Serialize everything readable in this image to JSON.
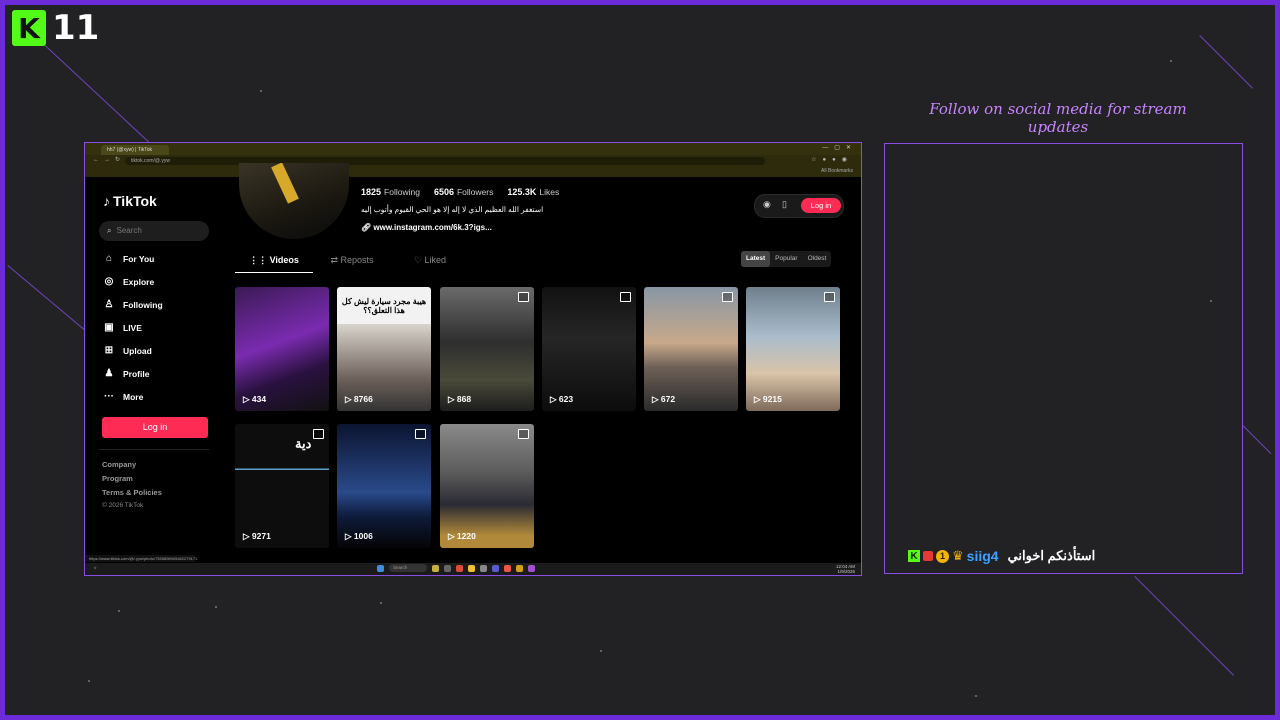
{
  "overlay": {
    "kick_badge": "11",
    "follow_text": "Follow on social media for stream updates",
    "chat": {
      "user": "siig4",
      "message": "استأذنكم اخواني"
    },
    "accent_color": "#6c2bd9"
  },
  "browser": {
    "tab_title": "hh7 (@xyw) | TikTok",
    "url": "tiktok.com/@.yyw",
    "bookmark_right": "All Bookmarks",
    "status_url": "https://www.tiktok.com/@/.yyw/photo/7355898905462279171"
  },
  "tiktok": {
    "brand": "TikTok",
    "search_placeholder": "Search",
    "nav": [
      {
        "label": "For You",
        "icon": "home-icon"
      },
      {
        "label": "Explore",
        "icon": "compass-icon"
      },
      {
        "label": "Following",
        "icon": "following-icon"
      },
      {
        "label": "LIVE",
        "icon": "live-icon"
      },
      {
        "label": "Upload",
        "icon": "upload-icon"
      },
      {
        "label": "Profile",
        "icon": "profile-icon"
      },
      {
        "label": "More",
        "icon": "more-icon"
      }
    ],
    "login_label": "Log in",
    "footer": {
      "company": "Company",
      "program": "Program",
      "terms": "Terms & Policies",
      "copyright": "© 2026 TikTok"
    },
    "profile": {
      "following_count": "1825",
      "following_label": "Following",
      "followers_count": "6506",
      "followers_label": "Followers",
      "likes_count": "125.3K",
      "likes_label": "Likes",
      "bio": "استغفر الله العظيم الذي لا إله إلا هو الحي القيوم وأتوب إليه",
      "link": "www.instagram.com/6k.3?igs..."
    },
    "tabs": {
      "videos": "Videos",
      "reposts": "Reposts",
      "liked": "Liked"
    },
    "sort": {
      "latest": "Latest",
      "popular": "Popular",
      "oldest": "Oldest"
    },
    "videos": [
      {
        "views": "434"
      },
      {
        "views": "8766",
        "caption": "هيبة مجرد سيارة ليش كل هذا التعلق؟؟"
      },
      {
        "views": "868"
      },
      {
        "views": "623"
      },
      {
        "views": "672"
      },
      {
        "views": "9215"
      },
      {
        "views": "9271",
        "caption": "دية"
      },
      {
        "views": "1006"
      },
      {
        "views": "1220"
      }
    ]
  },
  "taskbar": {
    "search": "Search",
    "time": "12:04 AM",
    "date": "1/9/2026"
  }
}
